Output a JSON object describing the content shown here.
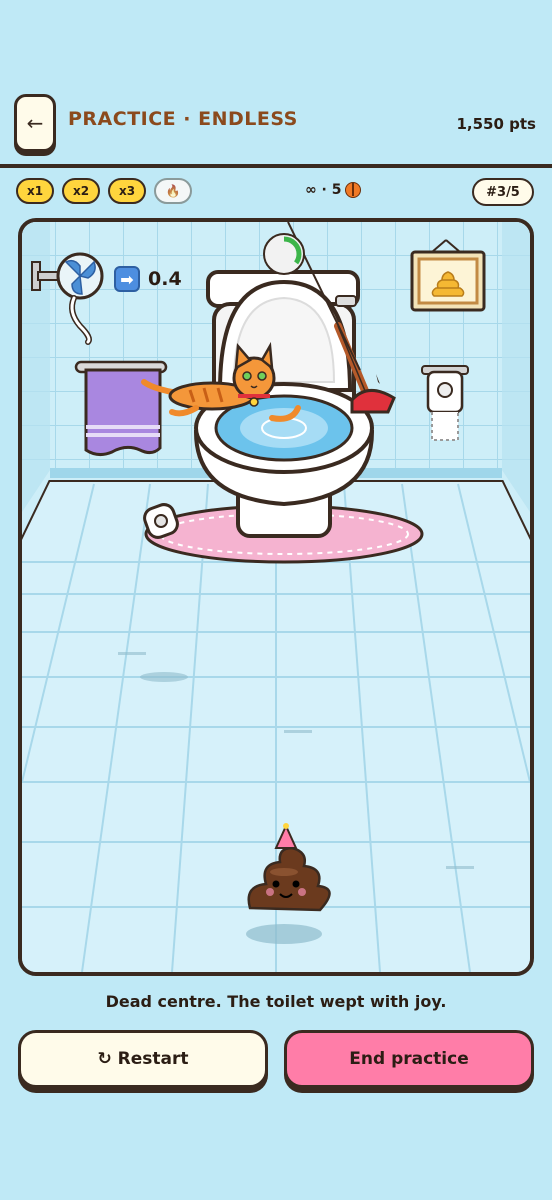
{
  "header": {
    "back_icon": "←",
    "title": "PRACTICE · ENDLESS",
    "points": "1,550 pts"
  },
  "multipliers": [
    {
      "label": "x1",
      "active": true
    },
    {
      "label": "x2",
      "active": true
    },
    {
      "label": "x3",
      "active": true
    },
    {
      "label": "🔥",
      "active": false
    }
  ],
  "shots": {
    "label": "∞ · 5",
    "icon": "basketball-icon"
  },
  "round": {
    "label": "#3/5"
  },
  "wind": {
    "arrow": "➡",
    "value": "0.4"
  },
  "timer_fraction": 0.35,
  "message": "Dead centre. The toilet wept with joy.",
  "actions": {
    "restart_label": "↻ Restart",
    "end_label": "End practice"
  },
  "colors": {
    "background": "#bfe9f6",
    "accent_yellow": "#ffd53d",
    "end_button": "#ff7da8",
    "title": "#8b4a1d"
  }
}
